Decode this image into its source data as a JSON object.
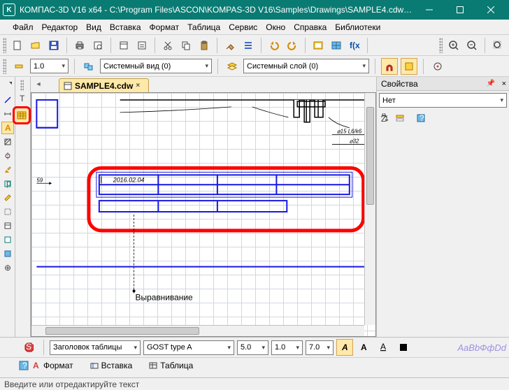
{
  "window": {
    "title": "КОМПАС-3D V16  x64 - C:\\Program Files\\ASCON\\KOMPAS-3D V16\\Samples\\Drawings\\SAMPLE4.cdw (то..."
  },
  "menu": {
    "file": "Файл",
    "editor": "Редактор",
    "view": "Вид",
    "insert": "Вставка",
    "format": "Формат",
    "table": "Таблица",
    "service": "Сервис",
    "window": "Окно",
    "help": "Справка",
    "libraries": "Библиотеки"
  },
  "toolbar2": {
    "scale": "1.0",
    "view_name": "Системный вид (0)",
    "layer_name": "Системный слой (0)"
  },
  "tabs": {
    "active": "SAMPLE4.cdw"
  },
  "props_panel": {
    "title": "Свойства",
    "filter": "Нет"
  },
  "canvas": {
    "date_text": "2016.02.04",
    "dim_label": "59",
    "align_label": "Выравнивание",
    "phi15": "⌀15 L6/k6",
    "phi32": "⌀32"
  },
  "propbar": {
    "header_style": "Заголовок таблицы",
    "font": "GOST type A",
    "size1": "5.0",
    "size2": "1.0",
    "size3": "7.0",
    "preview": "АаВbФфDd",
    "tab_format": "Формат",
    "tab_insert": "Вставка",
    "tab_table": "Таблица"
  },
  "status": {
    "text": "Введите или отредактируйте текст"
  }
}
